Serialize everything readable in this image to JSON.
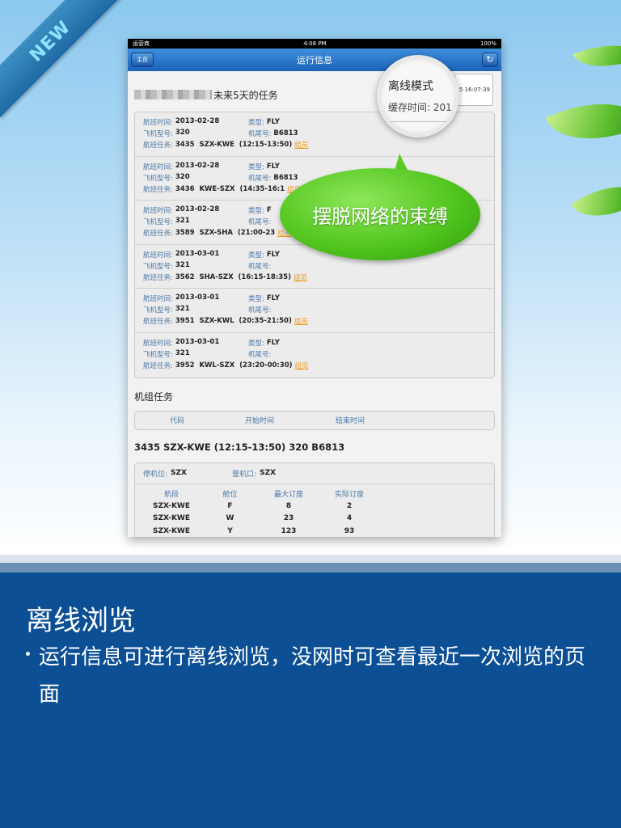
{
  "badge": {
    "new": "NEW"
  },
  "device": {
    "status": {
      "carrier": "运营商",
      "time": "4:08 PM",
      "battery": "100%"
    },
    "nav": {
      "home": "主页",
      "title": "运行信息",
      "refresh_icon": "refresh-icon"
    },
    "task_header": "未来5天的任务",
    "offline_time_partial": "5 16:07:39",
    "labels": {
      "flight_time": "航班时间:",
      "type": "类型:",
      "aircraft_model": "飞机型号:",
      "tail_no": "机尾号:",
      "flight_task": "航班任务:",
      "crew": "组员"
    },
    "flights": [
      {
        "date": "2013-02-28",
        "type": "FLY",
        "model": "320",
        "tail": "B6813",
        "task": "3435  SZX-KWE  (12:15-13:50)"
      },
      {
        "date": "2013-02-28",
        "type": "FLY",
        "model": "320",
        "tail": "B6813",
        "task": "3436  KWE-SZX  (14:35-16:1"
      },
      {
        "date": "2013-02-28",
        "type": "F",
        "model": "321",
        "tail": "",
        "task": "3589  SZX-SHA  (21:00-23"
      },
      {
        "date": "2013-03-01",
        "type": "FLY",
        "model": "321",
        "tail": "",
        "task": "3562  SHA-SZX  (16:15-18:35)"
      },
      {
        "date": "2013-03-01",
        "type": "FLY",
        "model": "321",
        "tail": "",
        "task": "3951  SZX-KWL  (20:35-21:50)"
      },
      {
        "date": "2013-03-01",
        "type": "FLY",
        "model": "321",
        "tail": "",
        "task": "3952  KWL-SZX  (23:20-00:30)"
      }
    ],
    "crew_section": {
      "title": "机组任务",
      "headers": [
        "代码",
        "开始时间",
        "结束时间"
      ]
    },
    "flight_detail": {
      "title": "3435 SZX-KWE (12:15-13:50) 320 B6813",
      "stand_label": "停机位:",
      "stand_value": "SZX",
      "gate_label": "登机口:",
      "gate_value": "SZX",
      "seat_headers": [
        "航段",
        "舱位",
        "最大订座",
        "实际订座"
      ],
      "seats": [
        [
          "SZX-KWE",
          "F",
          "8",
          "2"
        ],
        [
          "SZX-KWE",
          "W",
          "23",
          "4"
        ],
        [
          "SZX-KWE",
          "Y",
          "123",
          "93"
        ]
      ]
    }
  },
  "magnifier": {
    "line1": "离线模式",
    "line2": "缓存时间: 201"
  },
  "bubble": "摆脱网络的束缚",
  "promo": {
    "heading": "离线浏览",
    "bullet": "运行信息可进行离线浏览，没网时可查看最近一次浏览的页面"
  }
}
